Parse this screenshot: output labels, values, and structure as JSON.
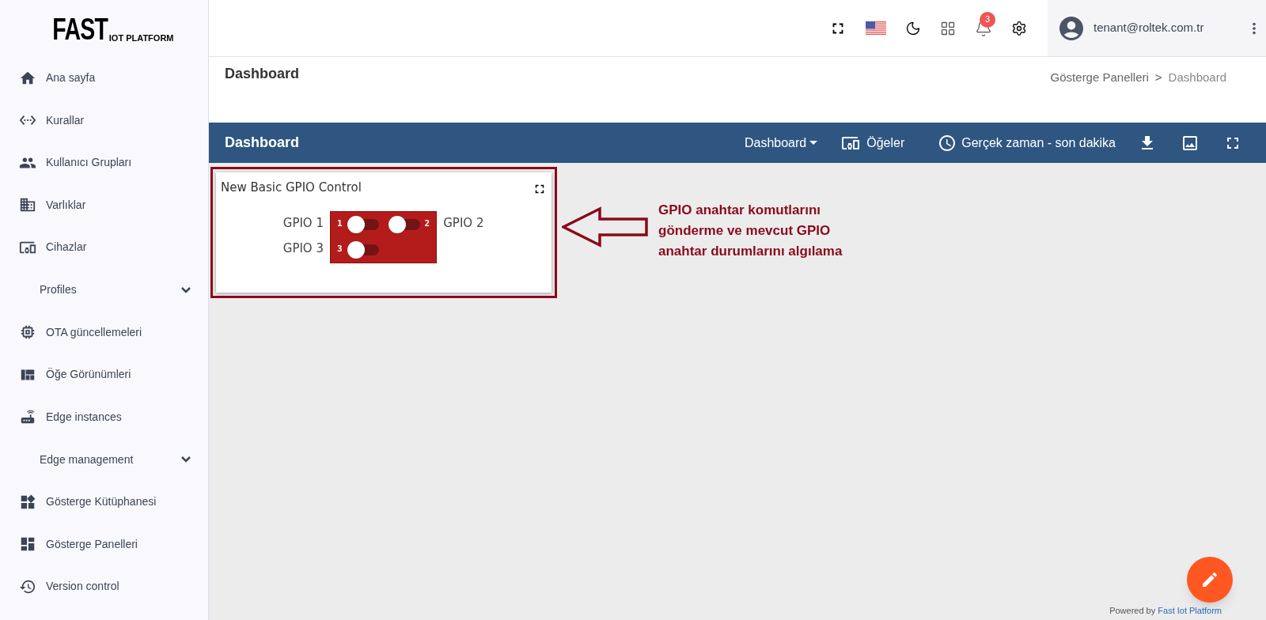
{
  "logo": {
    "main": "FAST",
    "sub": "IOT PLATFORM"
  },
  "sidebar": {
    "items": [
      {
        "kind": "link",
        "label": "Ana sayfa"
      },
      {
        "kind": "link",
        "label": "Kurallar"
      },
      {
        "kind": "link",
        "label": "Kullanıcı Grupları"
      },
      {
        "kind": "link",
        "label": "Varlıklar"
      },
      {
        "kind": "link",
        "label": "Cihazlar"
      },
      {
        "kind": "group",
        "label": "Profiles",
        "expanded": false
      },
      {
        "kind": "link",
        "label": "OTA güncellemeleri"
      },
      {
        "kind": "link",
        "label": "Öğe Görünümleri"
      },
      {
        "kind": "link",
        "label": "Edge instances"
      },
      {
        "kind": "group",
        "label": "Edge management",
        "expanded": false
      },
      {
        "kind": "link",
        "label": "Gösterge Kütüphanesi"
      },
      {
        "kind": "link",
        "label": "Gösterge Panelleri"
      },
      {
        "kind": "link",
        "label": "Version control"
      }
    ]
  },
  "topbar": {
    "notification_count": "3",
    "user_email": "tenant@roltek.com.tr"
  },
  "page": {
    "title": "Dashboard",
    "breadcrumb": [
      "Gösterge Panelleri",
      "Dashboard"
    ],
    "breadcrumb_separator": ">"
  },
  "toolbar": {
    "title": "Dashboard",
    "dashboard_select": "Dashboard",
    "widgets_button": "Öğeler",
    "time_window": "Gerçek zaman - son dakika"
  },
  "widget": {
    "title": "New Basic GPIO Control",
    "highlighted": true,
    "switches": [
      {
        "kind": "left",
        "label": "GPIO 1",
        "pin": "1",
        "checked": false
      },
      {
        "kind": "right",
        "label": "GPIO 2",
        "pin": "2",
        "checked": false
      },
      {
        "kind": "left",
        "label": "GPIO 3",
        "pin": "3",
        "checked": false
      }
    ]
  },
  "annotation": {
    "text": "GPIO anahtar komutlarını gönderme ve mevcut GPIO anahtar durumlarını algılama"
  },
  "footer": {
    "prefix": "Powered by",
    "link": "Fast Iot Platform"
  }
}
